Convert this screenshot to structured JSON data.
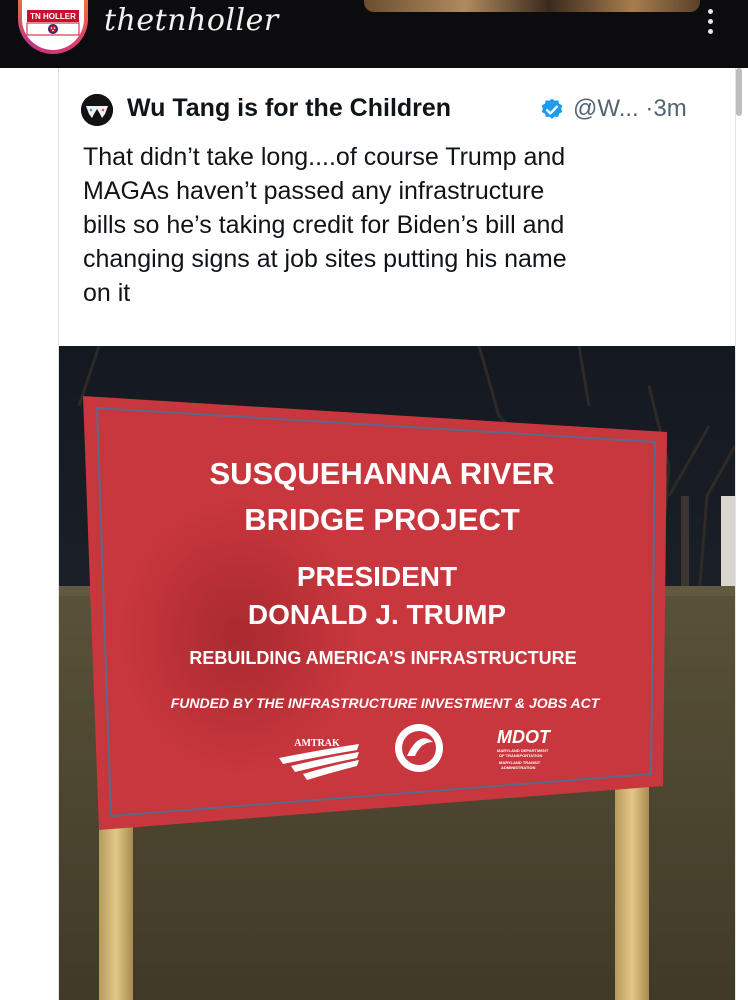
{
  "topbar": {
    "logo_text": "TN HOLLER",
    "account_handle": "thetnholler",
    "more_icon": "vertical-ellipsis-icon"
  },
  "tweet": {
    "author_name": "Wu Tang is for the Children",
    "verified_icon": "verified-badge-icon",
    "handle": "@W...",
    "separator": "·",
    "time": "3m",
    "text_lines": [
      "That didn’t take long....of course Trump and",
      "MAGAs haven’t passed any infrastructure",
      "bills so he’s taking credit for Biden’s bill and",
      "changing signs at job sites putting his name",
      "on it"
    ]
  },
  "sign": {
    "line1": "SUSQUEHANNA RIVER",
    "line2": "BRIDGE PROJECT",
    "line3": "PRESIDENT",
    "line4": "DONALD J. TRUMP",
    "line5": "REBUILDING AMERICA’S INFRASTRUCTURE",
    "line6": "FUNDED BY THE INFRASTRUCTURE INVESTMENT & JOBS ACT",
    "amtrak": "AMTRAK",
    "mdot": "MDOT",
    "mdot_sub1": "MARYLAND DEPARTMENT",
    "mdot_sub2": "OF TRANSPORTATION",
    "mdot_sub3": "MARYLAND TRANSIT",
    "mdot_sub4": "ADMINISTRATION"
  },
  "colors": {
    "topbar_bg": "#0c0c0e",
    "sign_red": "#c8373d",
    "verified_blue": "#1d9bf0",
    "text_primary": "#0f1419",
    "text_secondary": "#536471"
  }
}
